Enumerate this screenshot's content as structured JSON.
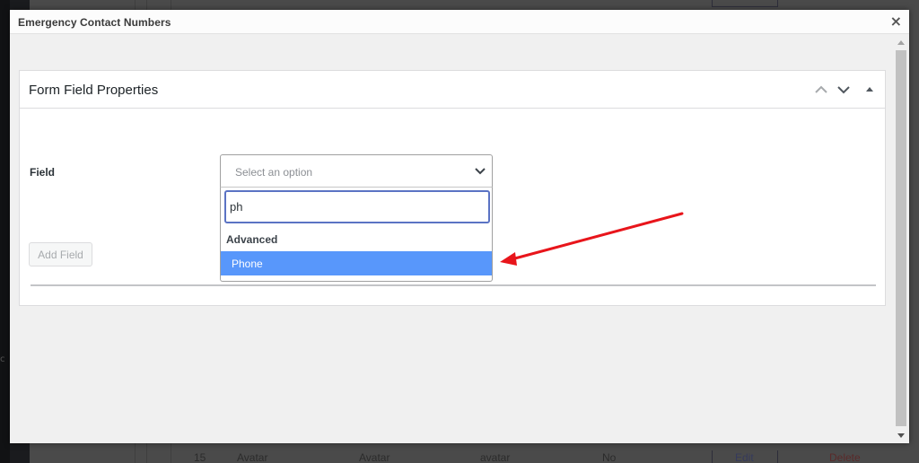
{
  "background": {
    "sidebar_fragment": "c",
    "table_row": {
      "id": "15",
      "label": "Avatar",
      "name": "Avatar",
      "key": "avatar",
      "required": "No",
      "edit_label": "Edit",
      "delete_label": "Delete"
    }
  },
  "modal": {
    "title": "Emergency Contact Numbers",
    "close_icon": "×"
  },
  "panel": {
    "title": "Form Field Properties",
    "controls": [
      "move-up",
      "move-down",
      "toggle-panel"
    ]
  },
  "form": {
    "field_label": "Field",
    "select": {
      "placeholder": "Select an option",
      "search_value": "ph",
      "groups": [
        {
          "label": "Advanced",
          "options": [
            {
              "label": "Phone",
              "highlighted": true
            }
          ]
        }
      ]
    },
    "add_field_button": "Add Field"
  },
  "colors": {
    "highlight": "#5897fb",
    "search_focus": "#5b73c4",
    "annotation_arrow": "#e8151b"
  }
}
